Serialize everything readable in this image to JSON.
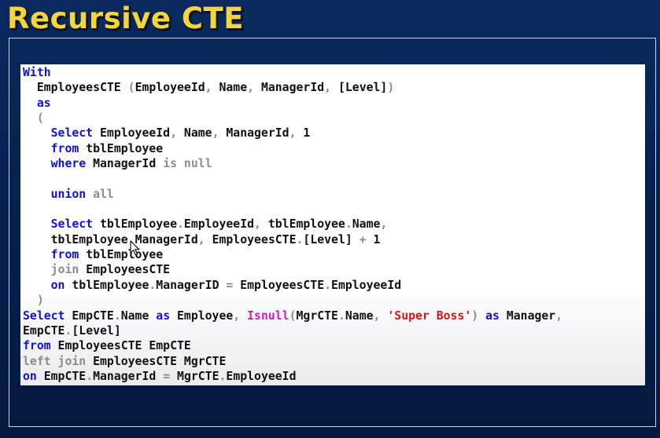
{
  "slide": {
    "title": "Recursive CTE"
  },
  "code": {
    "lines": [
      [
        {
          "t": "With",
          "c": "kw"
        }
      ],
      [
        {
          "t": "  EmployeesCTE "
        },
        {
          "t": "(",
          "c": "gr"
        },
        {
          "t": "EmployeeId"
        },
        {
          "t": ",",
          "c": "gr"
        },
        {
          "t": " Name"
        },
        {
          "t": ",",
          "c": "gr"
        },
        {
          "t": " ManagerId"
        },
        {
          "t": ",",
          "c": "gr"
        },
        {
          "t": " [Level]"
        },
        {
          "t": ")",
          "c": "gr"
        }
      ],
      [
        {
          "t": "  "
        },
        {
          "t": "as",
          "c": "kw"
        }
      ],
      [
        {
          "t": "  "
        },
        {
          "t": "(",
          "c": "gr"
        }
      ],
      [
        {
          "t": "    "
        },
        {
          "t": "Select",
          "c": "kw"
        },
        {
          "t": " EmployeeId"
        },
        {
          "t": ",",
          "c": "gr"
        },
        {
          "t": " Name"
        },
        {
          "t": ",",
          "c": "gr"
        },
        {
          "t": " ManagerId"
        },
        {
          "t": ",",
          "c": "gr"
        },
        {
          "t": " 1"
        }
      ],
      [
        {
          "t": "    "
        },
        {
          "t": "from",
          "c": "kw"
        },
        {
          "t": " tblEmployee"
        }
      ],
      [
        {
          "t": "    "
        },
        {
          "t": "where",
          "c": "kw"
        },
        {
          "t": " ManagerId "
        },
        {
          "t": "is null",
          "c": "gr"
        }
      ],
      [
        {
          "t": ""
        }
      ],
      [
        {
          "t": "    "
        },
        {
          "t": "union",
          "c": "kw"
        },
        {
          "t": " all",
          "c": "gr"
        }
      ],
      [
        {
          "t": ""
        }
      ],
      [
        {
          "t": "    "
        },
        {
          "t": "Select",
          "c": "kw"
        },
        {
          "t": " tblEmployee"
        },
        {
          "t": ".",
          "c": "gr"
        },
        {
          "t": "EmployeeId"
        },
        {
          "t": ",",
          "c": "gr"
        },
        {
          "t": " tblEmployee"
        },
        {
          "t": ".",
          "c": "gr"
        },
        {
          "t": "Name"
        },
        {
          "t": ",",
          "c": "gr"
        }
      ],
      [
        {
          "t": "    tblEmployee"
        },
        {
          "t": ".",
          "c": "gr"
        },
        {
          "t": "ManagerId"
        },
        {
          "t": ",",
          "c": "gr"
        },
        {
          "t": " EmployeesCTE"
        },
        {
          "t": ".",
          "c": "gr"
        },
        {
          "t": "[Level] "
        },
        {
          "t": "+",
          "c": "gr"
        },
        {
          "t": " 1"
        }
      ],
      [
        {
          "t": "    "
        },
        {
          "t": "from",
          "c": "kw"
        },
        {
          "t": " tblEmployee"
        }
      ],
      [
        {
          "t": "    "
        },
        {
          "t": "join",
          "c": "gr"
        },
        {
          "t": " EmployeesCTE"
        }
      ],
      [
        {
          "t": "    "
        },
        {
          "t": "on",
          "c": "kw"
        },
        {
          "t": " tblEmployee"
        },
        {
          "t": ".",
          "c": "gr"
        },
        {
          "t": "ManagerID "
        },
        {
          "t": "=",
          "c": "gr"
        },
        {
          "t": " EmployeesCTE"
        },
        {
          "t": ".",
          "c": "gr"
        },
        {
          "t": "EmployeeId"
        }
      ],
      [
        {
          "t": "  "
        },
        {
          "t": ")",
          "c": "gr"
        }
      ],
      [
        {
          "t": "Select",
          "c": "kw"
        },
        {
          "t": " EmpCTE"
        },
        {
          "t": ".",
          "c": "gr"
        },
        {
          "t": "Name "
        },
        {
          "t": "as",
          "c": "kw"
        },
        {
          "t": " Employee"
        },
        {
          "t": ",",
          "c": "gr"
        },
        {
          "t": " "
        },
        {
          "t": "Isnull",
          "c": "fn"
        },
        {
          "t": "(",
          "c": "gr"
        },
        {
          "t": "MgrCTE"
        },
        {
          "t": ".",
          "c": "gr"
        },
        {
          "t": "Name"
        },
        {
          "t": ",",
          "c": "gr"
        },
        {
          "t": " "
        },
        {
          "t": "'Super Boss'",
          "c": "st"
        },
        {
          "t": ")",
          "c": "gr"
        },
        {
          "t": " "
        },
        {
          "t": "as",
          "c": "kw"
        },
        {
          "t": " Manager"
        },
        {
          "t": ",",
          "c": "gr"
        }
      ],
      [
        {
          "t": "EmpCTE"
        },
        {
          "t": ".",
          "c": "gr"
        },
        {
          "t": "[Level]"
        }
      ],
      [
        {
          "t": "from",
          "c": "kw"
        },
        {
          "t": " EmployeesCTE EmpCTE"
        }
      ],
      [
        {
          "t": "left join",
          "c": "gr"
        },
        {
          "t": " EmployeesCTE MgrCTE"
        }
      ],
      [
        {
          "t": "on",
          "c": "kw"
        },
        {
          "t": " EmpCTE"
        },
        {
          "t": ".",
          "c": "gr"
        },
        {
          "t": "ManagerId "
        },
        {
          "t": "=",
          "c": "gr"
        },
        {
          "t": " MgrCTE"
        },
        {
          "t": ".",
          "c": "gr"
        },
        {
          "t": "EmployeeId"
        }
      ]
    ]
  },
  "icons": {
    "cursor": "mouse-pointer-icon"
  }
}
